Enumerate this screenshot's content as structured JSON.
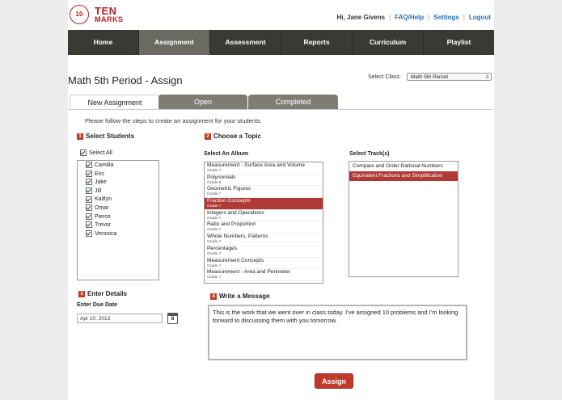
{
  "logo": {
    "badge": "10",
    "line1": "TEN",
    "line2": "MARKS"
  },
  "header": {
    "greeting": "Hi, Jane Givens",
    "faq": "FAQ/Help",
    "settings": "Settings",
    "logout": "Logout"
  },
  "nav": {
    "items": [
      "Home",
      "Assignment",
      "Assessment",
      "Reports",
      "Curriculum",
      "Playlist"
    ]
  },
  "page": {
    "title": "Math 5th Period - Assign",
    "select_class_label": "Select Class:",
    "select_class_value": "Math 5th Period"
  },
  "tabs": {
    "new": "New Assignment",
    "open": "Open",
    "completed": "Completed"
  },
  "intro": "Please follow the steps to create an assignment for your students.",
  "step1": {
    "num": "1",
    "title": "Select Students",
    "select_all": "Select All",
    "students": [
      "Camilia",
      "Eric",
      "Jake",
      "Jill",
      "Kaitlyn",
      "Omar",
      "Pierce",
      "Trevor",
      "Veronica"
    ]
  },
  "step2": {
    "num": "2",
    "title": "Choose a Topic",
    "album_label": "Select An Album",
    "track_label": "Select Track(s)",
    "albums": [
      {
        "name": "Measurement - Surface Area and Volume",
        "grade": "Grade 7"
      },
      {
        "name": "Polynomials",
        "grade": "Grade 8"
      },
      {
        "name": "Geometric Figures",
        "grade": "Grade 7"
      },
      {
        "name": "Fraction Concepts",
        "grade": "Grade 7"
      },
      {
        "name": "Integers and Operations",
        "grade": "Grade 7"
      },
      {
        "name": "Ratio and Proportion",
        "grade": "Grade 7"
      },
      {
        "name": "Whole Numbers, Patterns",
        "grade": "Grade 7"
      },
      {
        "name": "Percentages",
        "grade": "Grade 7"
      },
      {
        "name": "Measurement Concepts",
        "grade": "Grade 7"
      },
      {
        "name": "Measurement - Area and Perimeter",
        "grade": "Grade 7"
      }
    ],
    "tracks": [
      "Compare and Order Rational Numbers",
      "Equivalent Fractions and Simplification"
    ]
  },
  "step3": {
    "num": "3",
    "title": "Enter Details",
    "due_label": "Enter Due Date",
    "due_value": "Apr 10, 2013",
    "calendar_day": "8"
  },
  "step4": {
    "num": "4",
    "title": "Write a Message",
    "message": "This is the work that we went over in class today. I've assigned 10 problems and I'm looking forward to discussing them with you tomorrow."
  },
  "assign_button": "Assign",
  "colors": {
    "brand": "#b22222",
    "nav_bg": "#3a3a35",
    "selected": "#b03a35",
    "tab_inactive": "#7f7d73"
  },
  "icons": {
    "checkbox": "checkmark-icon",
    "calendar": "calendar-icon",
    "dropdown": "chevron-down-icon"
  }
}
